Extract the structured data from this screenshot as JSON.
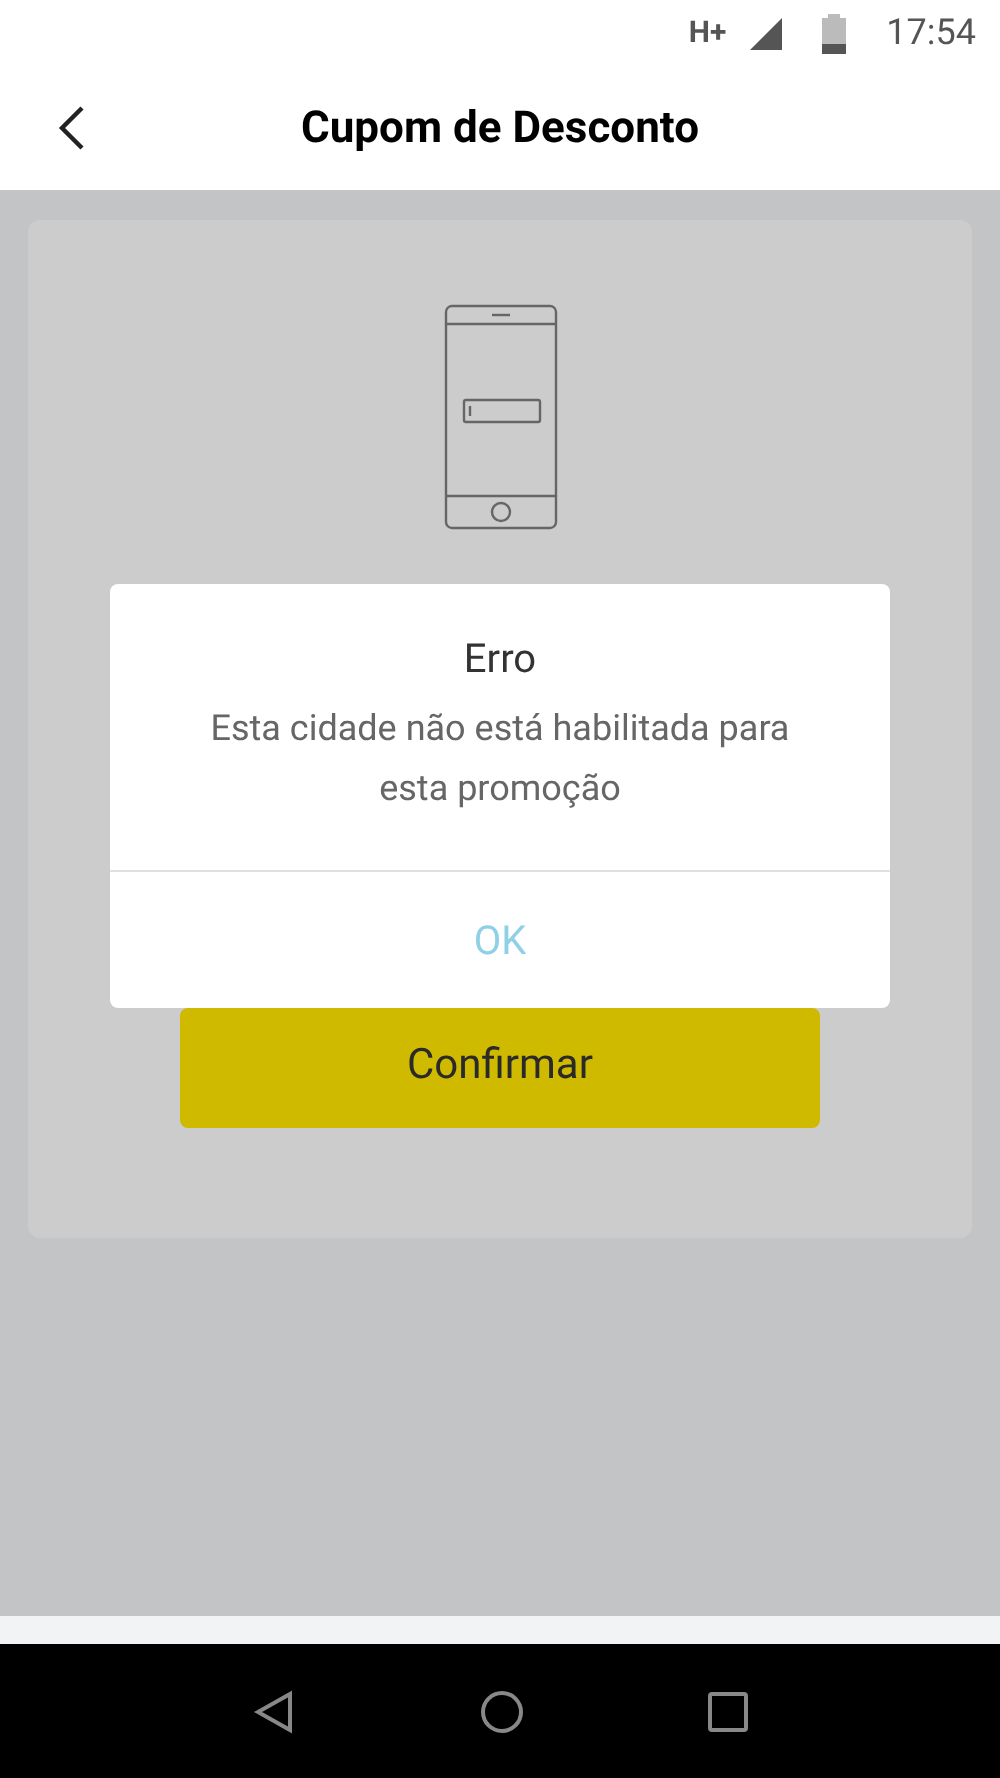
{
  "status_bar": {
    "network": "H+",
    "time": "17:54"
  },
  "header": {
    "title": "Cupom de Desconto"
  },
  "card": {
    "confirm_button": "Confirmar"
  },
  "dialog": {
    "title": "Erro",
    "message": "Esta cidade não está habilitada para esta promoção",
    "button": "OK"
  }
}
